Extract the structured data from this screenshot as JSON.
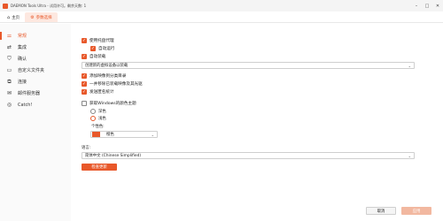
{
  "window": {
    "title": "DAEMON Tools Ultra - 试用许可。剩余天数: 1",
    "minimize_icon": "minimize-icon",
    "maximize_icon": "maximize-icon",
    "close_icon": "close-icon"
  },
  "tabs": [
    {
      "label": "主页",
      "icon": "home-icon"
    },
    {
      "label": "参数选择",
      "icon": "gear-icon"
    }
  ],
  "sidebar": {
    "items": [
      {
        "label": "常规",
        "icon": "sliders-icon"
      },
      {
        "label": "集成",
        "icon": "shuffle-icon"
      },
      {
        "label": "确认",
        "icon": "shield-icon"
      },
      {
        "label": "自定义文件夹",
        "icon": "folder-icon"
      },
      {
        "label": "连接",
        "icon": "network-icon"
      },
      {
        "label": "邮件服务器",
        "icon": "mail-icon"
      },
      {
        "label": "Catch!",
        "icon": "catch-icon"
      }
    ]
  },
  "general": {
    "use_tray_agent": "使用托盘代理",
    "auto_run": "自动运行",
    "auto_mount": "自动装载",
    "create_virtual_device": "创建新的虚拟设备以装载",
    "add_image_to_catalog": "添加映像到分类目录",
    "remember_unmounted_and_write": "一并移除已装载映像及其光驱",
    "send_anonymous_stats": "发送匿名统计",
    "get_windows_theme": "获取Windows的颜色主题",
    "theme_dark": "深色",
    "theme_light": "浅色",
    "personal_color": "个性色:",
    "color_name": "橙色",
    "language_label": "语言:",
    "language_value": "简体中文 (Chinese Simplified)",
    "check_updates": "检查更新"
  },
  "footer": {
    "cancel": "取消",
    "apply": "应用"
  },
  "colors": {
    "accent": "#e8582a"
  }
}
